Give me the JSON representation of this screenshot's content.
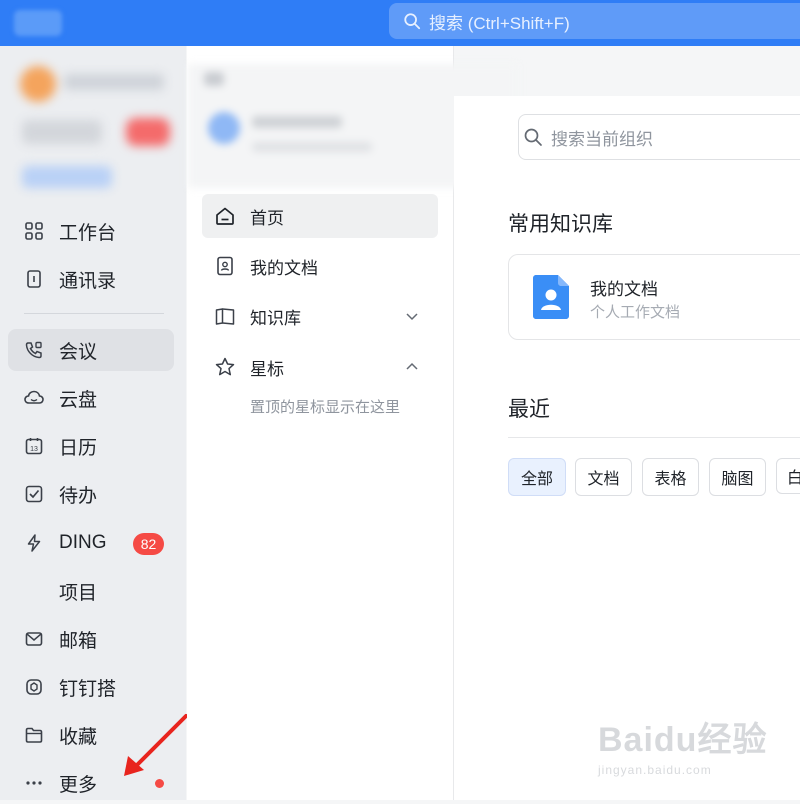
{
  "topbar": {
    "search_placeholder": "搜索 (Ctrl+Shift+F)"
  },
  "sidebar": {
    "items": [
      {
        "label": "工作台",
        "icon": "grid-icon"
      },
      {
        "label": "通讯录",
        "icon": "contacts-icon"
      },
      {
        "label": "会议",
        "icon": "phone-video-icon",
        "active": true
      },
      {
        "label": "云盘",
        "icon": "cloud-icon"
      },
      {
        "label": "日历",
        "icon": "calendar-icon",
        "icon_text": "13"
      },
      {
        "label": "待办",
        "icon": "checkbox-icon"
      },
      {
        "label": "DING",
        "icon": "lightning-icon",
        "badge": "82"
      },
      {
        "label": "项目",
        "icon": ""
      },
      {
        "label": "邮箱",
        "icon": "mail-icon"
      },
      {
        "label": "钉钉搭",
        "icon": "builder-icon"
      },
      {
        "label": "收藏",
        "icon": "folder-icon"
      },
      {
        "label": "更多",
        "icon": "more-dots-icon"
      }
    ]
  },
  "panel": {
    "items": [
      {
        "label": "首页",
        "icon": "home-icon",
        "active": true
      },
      {
        "label": "我的文档",
        "icon": "user-doc-icon"
      },
      {
        "label": "知识库",
        "icon": "book-icon",
        "chevron": "down"
      },
      {
        "label": "星标",
        "icon": "star-icon",
        "chevron": "up"
      }
    ],
    "star_hint": "置顶的星标显示在这里"
  },
  "main": {
    "search_placeholder": "搜索当前组织",
    "frequent_heading": "常用知识库",
    "card": {
      "title": "我的文档",
      "subtitle": "个人工作文档"
    },
    "recent_heading": "最近",
    "filters": [
      "全部",
      "文档",
      "表格",
      "脑图",
      "白"
    ]
  },
  "watermark": {
    "line1": "Baidu经验",
    "line2": "jingyan.baidu.com"
  },
  "colors": {
    "accent": "#2f7df6",
    "badge": "#f54a45",
    "doc_icon": "#3a8ef6"
  }
}
